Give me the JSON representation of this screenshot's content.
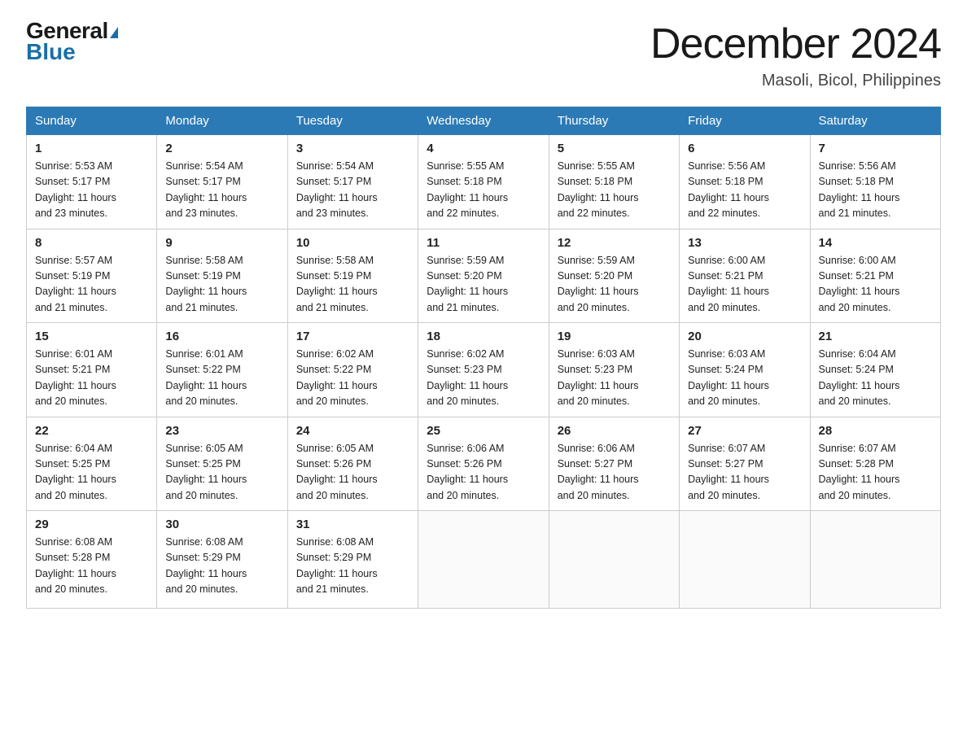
{
  "logo": {
    "general": "General",
    "blue": "Blue"
  },
  "title": "December 2024",
  "location": "Masoli, Bicol, Philippines",
  "days_of_week": [
    "Sunday",
    "Monday",
    "Tuesday",
    "Wednesday",
    "Thursday",
    "Friday",
    "Saturday"
  ],
  "weeks": [
    [
      {
        "day": "1",
        "sunrise": "5:53 AM",
        "sunset": "5:17 PM",
        "daylight": "11 hours and 23 minutes."
      },
      {
        "day": "2",
        "sunrise": "5:54 AM",
        "sunset": "5:17 PM",
        "daylight": "11 hours and 23 minutes."
      },
      {
        "day": "3",
        "sunrise": "5:54 AM",
        "sunset": "5:17 PM",
        "daylight": "11 hours and 23 minutes."
      },
      {
        "day": "4",
        "sunrise": "5:55 AM",
        "sunset": "5:18 PM",
        "daylight": "11 hours and 22 minutes."
      },
      {
        "day": "5",
        "sunrise": "5:55 AM",
        "sunset": "5:18 PM",
        "daylight": "11 hours and 22 minutes."
      },
      {
        "day": "6",
        "sunrise": "5:56 AM",
        "sunset": "5:18 PM",
        "daylight": "11 hours and 22 minutes."
      },
      {
        "day": "7",
        "sunrise": "5:56 AM",
        "sunset": "5:18 PM",
        "daylight": "11 hours and 21 minutes."
      }
    ],
    [
      {
        "day": "8",
        "sunrise": "5:57 AM",
        "sunset": "5:19 PM",
        "daylight": "11 hours and 21 minutes."
      },
      {
        "day": "9",
        "sunrise": "5:58 AM",
        "sunset": "5:19 PM",
        "daylight": "11 hours and 21 minutes."
      },
      {
        "day": "10",
        "sunrise": "5:58 AM",
        "sunset": "5:19 PM",
        "daylight": "11 hours and 21 minutes."
      },
      {
        "day": "11",
        "sunrise": "5:59 AM",
        "sunset": "5:20 PM",
        "daylight": "11 hours and 21 minutes."
      },
      {
        "day": "12",
        "sunrise": "5:59 AM",
        "sunset": "5:20 PM",
        "daylight": "11 hours and 20 minutes."
      },
      {
        "day": "13",
        "sunrise": "6:00 AM",
        "sunset": "5:21 PM",
        "daylight": "11 hours and 20 minutes."
      },
      {
        "day": "14",
        "sunrise": "6:00 AM",
        "sunset": "5:21 PM",
        "daylight": "11 hours and 20 minutes."
      }
    ],
    [
      {
        "day": "15",
        "sunrise": "6:01 AM",
        "sunset": "5:21 PM",
        "daylight": "11 hours and 20 minutes."
      },
      {
        "day": "16",
        "sunrise": "6:01 AM",
        "sunset": "5:22 PM",
        "daylight": "11 hours and 20 minutes."
      },
      {
        "day": "17",
        "sunrise": "6:02 AM",
        "sunset": "5:22 PM",
        "daylight": "11 hours and 20 minutes."
      },
      {
        "day": "18",
        "sunrise": "6:02 AM",
        "sunset": "5:23 PM",
        "daylight": "11 hours and 20 minutes."
      },
      {
        "day": "19",
        "sunrise": "6:03 AM",
        "sunset": "5:23 PM",
        "daylight": "11 hours and 20 minutes."
      },
      {
        "day": "20",
        "sunrise": "6:03 AM",
        "sunset": "5:24 PM",
        "daylight": "11 hours and 20 minutes."
      },
      {
        "day": "21",
        "sunrise": "6:04 AM",
        "sunset": "5:24 PM",
        "daylight": "11 hours and 20 minutes."
      }
    ],
    [
      {
        "day": "22",
        "sunrise": "6:04 AM",
        "sunset": "5:25 PM",
        "daylight": "11 hours and 20 minutes."
      },
      {
        "day": "23",
        "sunrise": "6:05 AM",
        "sunset": "5:25 PM",
        "daylight": "11 hours and 20 minutes."
      },
      {
        "day": "24",
        "sunrise": "6:05 AM",
        "sunset": "5:26 PM",
        "daylight": "11 hours and 20 minutes."
      },
      {
        "day": "25",
        "sunrise": "6:06 AM",
        "sunset": "5:26 PM",
        "daylight": "11 hours and 20 minutes."
      },
      {
        "day": "26",
        "sunrise": "6:06 AM",
        "sunset": "5:27 PM",
        "daylight": "11 hours and 20 minutes."
      },
      {
        "day": "27",
        "sunrise": "6:07 AM",
        "sunset": "5:27 PM",
        "daylight": "11 hours and 20 minutes."
      },
      {
        "day": "28",
        "sunrise": "6:07 AM",
        "sunset": "5:28 PM",
        "daylight": "11 hours and 20 minutes."
      }
    ],
    [
      {
        "day": "29",
        "sunrise": "6:08 AM",
        "sunset": "5:28 PM",
        "daylight": "11 hours and 20 minutes."
      },
      {
        "day": "30",
        "sunrise": "6:08 AM",
        "sunset": "5:29 PM",
        "daylight": "11 hours and 20 minutes."
      },
      {
        "day": "31",
        "sunrise": "6:08 AM",
        "sunset": "5:29 PM",
        "daylight": "11 hours and 21 minutes."
      },
      null,
      null,
      null,
      null
    ]
  ],
  "labels": {
    "sunrise": "Sunrise:",
    "sunset": "Sunset:",
    "daylight": "Daylight:"
  }
}
